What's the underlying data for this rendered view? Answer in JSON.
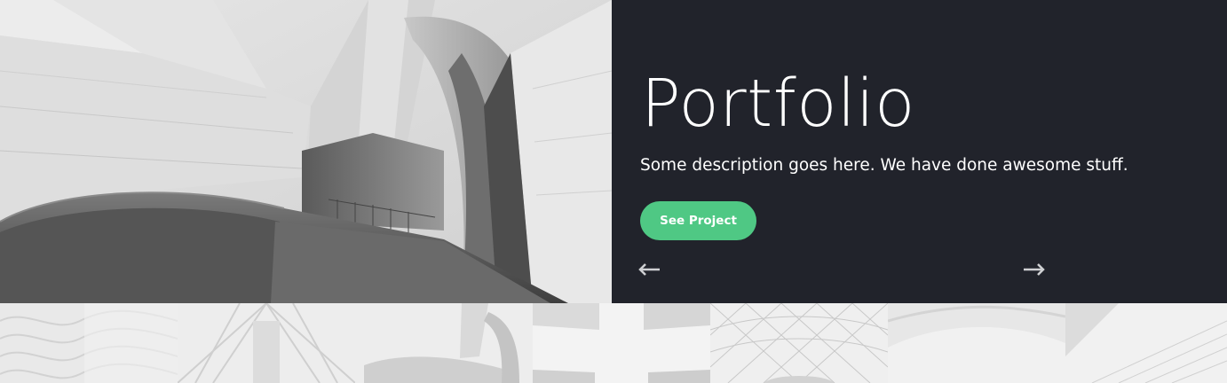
{
  "hero": {
    "title": "Portfolio",
    "description": "Some description goes here. We have done awesome stuff.",
    "cta_label": "See Project",
    "prev_icon": "arrow-left-icon",
    "next_icon": "arrow-right-icon",
    "image_alt": "architecture-photo"
  },
  "thumbnails": [
    {
      "name": "thumb-facade-pattern"
    },
    {
      "name": "thumb-glass-corridor"
    },
    {
      "name": "thumb-curved-building"
    },
    {
      "name": "thumb-sky-buildings"
    },
    {
      "name": "thumb-lattice-dome"
    },
    {
      "name": "thumb-curved-ceiling"
    },
    {
      "name": "thumb-tower-edge"
    }
  ],
  "colors": {
    "panel_bg": "#21232b",
    "accent": "#4fc884",
    "text": "#ffffff"
  }
}
